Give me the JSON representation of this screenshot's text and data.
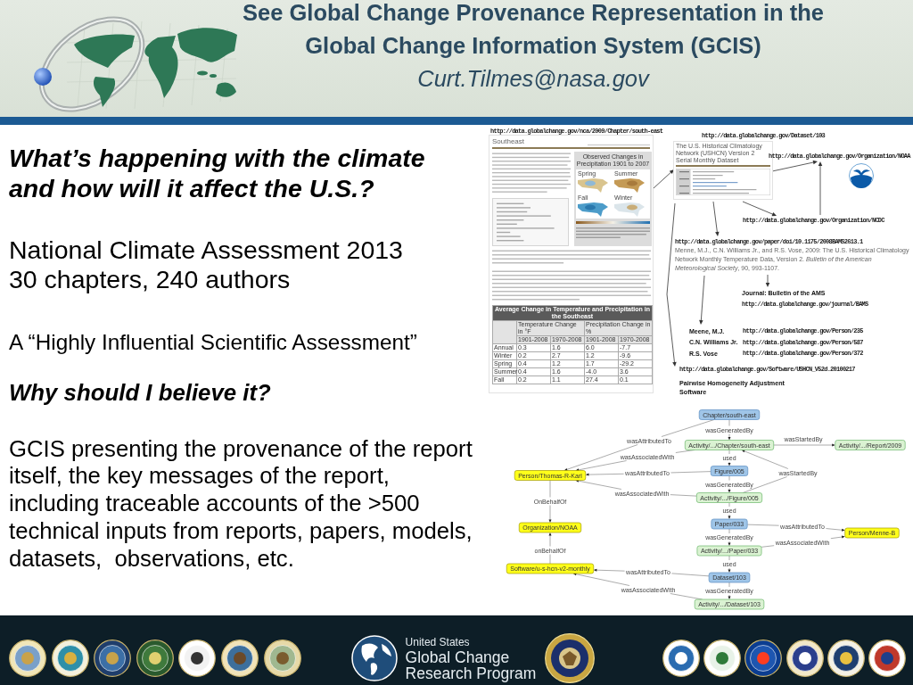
{
  "header": {
    "title": "See Global Change Provenance Representation in the Global Change Information System (GCIS)",
    "email": "Curt.Tilmes@nasa.gov"
  },
  "intro": {
    "question": "What’s happening with the climate and how will it affect the U.S.?",
    "report_name": "National Climate Assessment 2013",
    "report_stats": "30 chapters, 240 authors",
    "designation": "A “Highly Influential Scientific Assessment”",
    "trust_question": "Why should I believe it?",
    "answer": "GCIS presenting the provenance of the report itself, the key messages of the report, including traceable accounts of the >500 technical inputs from reports, papers, models, datasets,  observations, etc."
  },
  "chapter_page": {
    "url": "http://data.globalchange.gov/nca/2009/Chapter/south-east",
    "title": "Southeast",
    "figure": {
      "title": "Observed Changes in Precipitation 1901 to 2007",
      "panels": [
        "Spring",
        "Summer",
        "Fall",
        "Winter"
      ]
    },
    "table": {
      "title": "Average Change in Temperature and Precipitation in the Southeast",
      "groups": [
        "Temperature Change in °F",
        "Precipitation Change in %"
      ],
      "periods": [
        "1901-2008",
        "1970-2008",
        "1901-2008",
        "1970-2008"
      ],
      "rows": [
        {
          "season": "Annual",
          "values": [
            "0.3",
            "1.6",
            "6.0",
            "-7.7"
          ]
        },
        {
          "season": "Winter",
          "values": [
            "0.2",
            "2.7",
            "1.2",
            "-9.6"
          ]
        },
        {
          "season": "Spring",
          "values": [
            "0.4",
            "1.2",
            "1.7",
            "-29.2"
          ]
        },
        {
          "season": "Summer",
          "values": [
            "0.4",
            "1.6",
            "-4.0",
            "3.6"
          ]
        },
        {
          "season": "Fall",
          "values": [
            "0.2",
            "1.1",
            "27.4",
            "0.1"
          ]
        }
      ]
    }
  },
  "dataset_page": {
    "url": "http://data.globalchange.gov/Dataset/103",
    "title": "The U.S. Historical Climatology Network (USHCN) Version 2 Serial Monthly Dataset"
  },
  "organization_links": [
    "http://data.globalchange.gov/Organization/NOAA",
    "http://data.globalchange.gov/Organization/NCDC"
  ],
  "paper": {
    "url": "http://data.globalchange.gov/paper/doi/10.1175/2008BAMS2613.1",
    "citation": "Menne, M.J., C.N. Williams Jr., and R.S. Vose, 2009: The U.S. Historical Climatology Network Monthly Temperature Data, Version 2. *Bulletin of the American Meteorological Society*, 90, 993-1107."
  },
  "journal": {
    "name": "Journal: Bulletin of the AMS",
    "url": "http://data.globalchange.gov/journal/BAMS"
  },
  "people": [
    {
      "name": "Meene, M.J.",
      "url": "http://data.globalchange.gov/Person/235"
    },
    {
      "name": "C.N. Williams Jr.",
      "url": "http://data.globalchange.gov/Person/587"
    },
    {
      "name": "R.S. Vose",
      "url": "http://data.globalchange.gov/Person/372"
    }
  ],
  "software": {
    "url": "http://data.globalchange.gov/Software/USHCN_V52d.20100217",
    "name": "Pairwise Homogeneity Adjustment Software"
  },
  "provenance_graph": {
    "nodes": [
      {
        "label": "Chapter/south-east",
        "kind": "entity"
      },
      {
        "label": "Activity/.../Chapter/south-east",
        "kind": "activity"
      },
      {
        "label": "Activity/.../Report/2009",
        "kind": "activity"
      },
      {
        "label": "Person/Thomas-R-Karl",
        "kind": "agent"
      },
      {
        "label": "Figure/005",
        "kind": "entity"
      },
      {
        "label": "Activity/.../Figure/005",
        "kind": "activity"
      },
      {
        "label": "Organization/NOAA",
        "kind": "agent"
      },
      {
        "label": "Paper/033",
        "kind": "entity"
      },
      {
        "label": "Person/Menne-B",
        "kind": "agent"
      },
      {
        "label": "Activity/.../Paper/033",
        "kind": "activity"
      },
      {
        "label": "Software/u-s-hcn-v2-monthly",
        "kind": "agent"
      },
      {
        "label": "Dataset/103",
        "kind": "entity"
      },
      {
        "label": "Activity/.../Dataset/103",
        "kind": "activity"
      }
    ],
    "edges": [
      {
        "label": "wasGeneratedBy"
      },
      {
        "label": "wasAttributedTo"
      },
      {
        "label": "wasStartedBy"
      },
      {
        "label": "wasAssociatedWith"
      },
      {
        "label": "used"
      },
      {
        "label": "wasAttributedTo"
      },
      {
        "label": "wasStartedBy"
      },
      {
        "label": "wasGeneratedBy"
      },
      {
        "label": "wasAssociatedWith"
      },
      {
        "label": "OnBehalfOf"
      },
      {
        "label": "used"
      },
      {
        "label": "wasAttributedTo"
      },
      {
        "label": "wasGeneratedBy"
      },
      {
        "label": "wasAssociatedWith"
      },
      {
        "label": "onBehalfOf"
      },
      {
        "label": "used"
      },
      {
        "label": "wasAttributedTo"
      },
      {
        "label": "wasAssociatedWith"
      },
      {
        "label": "wasGeneratedBy"
      }
    ]
  },
  "footer": {
    "program_lines": [
      "United States",
      "Global Change",
      "Research Program"
    ]
  }
}
